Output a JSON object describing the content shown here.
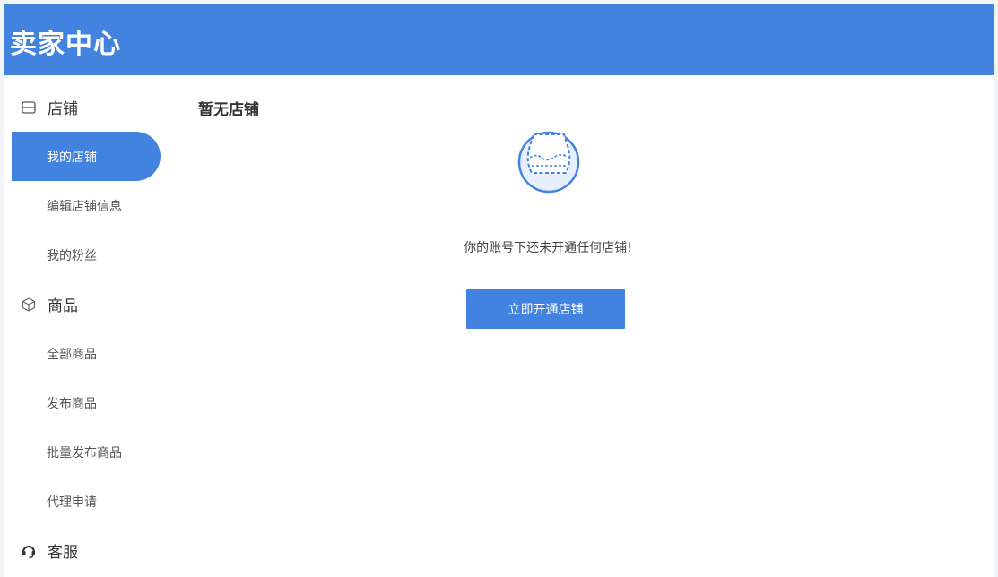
{
  "header": {
    "title": "卖家中心"
  },
  "sidebar": {
    "groups": [
      {
        "label": "店铺",
        "icon": "store-icon",
        "items": [
          {
            "label": "我的店铺",
            "active": true
          },
          {
            "label": "编辑店铺信息"
          },
          {
            "label": "我的粉丝"
          }
        ]
      },
      {
        "label": "商品",
        "icon": "cube-icon",
        "items": [
          {
            "label": "全部商品"
          },
          {
            "label": "发布商品"
          },
          {
            "label": "批量发布商品"
          },
          {
            "label": "代理申请"
          }
        ]
      },
      {
        "label": "客服",
        "icon": "headset-icon",
        "items": []
      }
    ]
  },
  "main": {
    "title": "暂无店铺",
    "empty_message": "你的账号下还未开通任何店铺!",
    "open_button_label": "立即开通店铺",
    "empty_icon": "empty-box-icon"
  },
  "colors": {
    "primary": "#4283e0",
    "background": "#ffffff",
    "page_background": "#f1f3f7"
  }
}
